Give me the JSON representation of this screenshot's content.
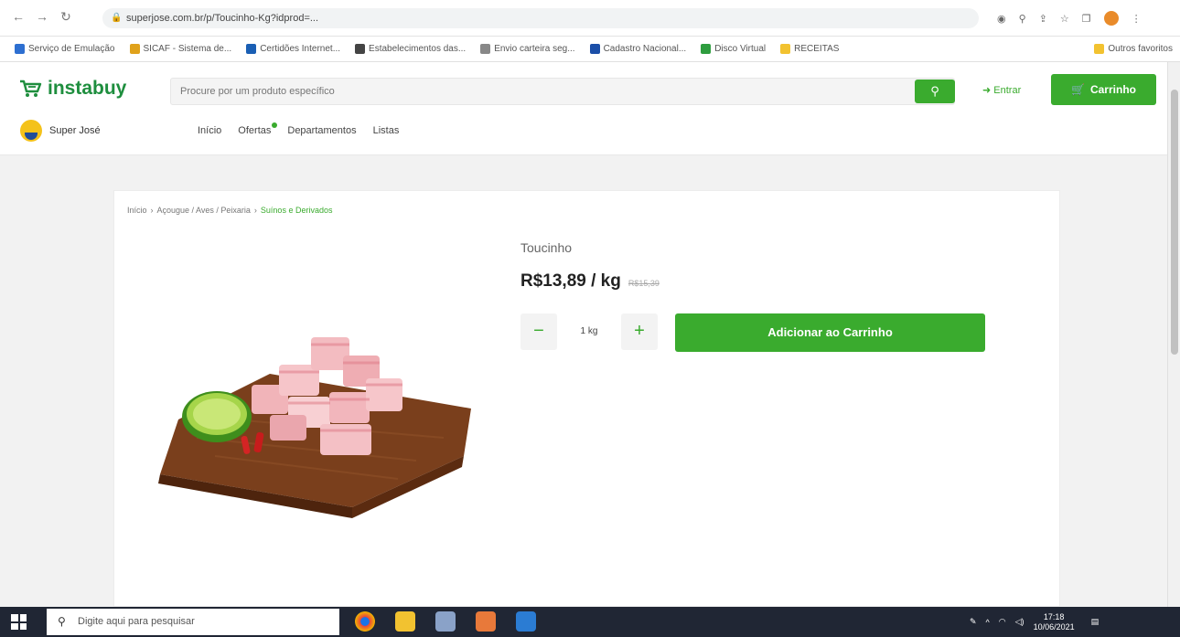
{
  "browser": {
    "url": "superjose.com.br/p/Toucinho-Kg?idprod=...",
    "bookmarks": [
      "Serviço de Emulação",
      "SICAF - Sistema de...",
      "Certidões Internet...",
      "Estabelecimentos das...",
      "Envio carteira seg...",
      "Cadastro Nacional...",
      "Disco Virtual",
      "RECEITAS",
      "Outros favoritos"
    ]
  },
  "header": {
    "logo_text": "instabuy",
    "search_placeholder": "Procure por um produto específico",
    "login_label": "Entrar",
    "cart_label": "Carrinho",
    "store_name": "Super José",
    "nav": [
      "Início",
      "Ofertas",
      "Departamentos",
      "Listas"
    ]
  },
  "breadcrumb": {
    "items": [
      "Início",
      "Açougue / Aves / Peixaria",
      "Suínos e Derivados"
    ]
  },
  "product": {
    "name": "Toucinho",
    "price": "R$13,89 / kg",
    "old_price": "R$15,39",
    "quantity": "1 kg",
    "add_to_cart_label": "Adicionar ao Carrinho"
  },
  "taskbar": {
    "search_placeholder": "Digite aqui para pesquisar",
    "time": "17:18",
    "date": "10/06/2021"
  },
  "colors": {
    "brand_green": "#3aab2e",
    "logo_green": "#1e8e3e"
  }
}
